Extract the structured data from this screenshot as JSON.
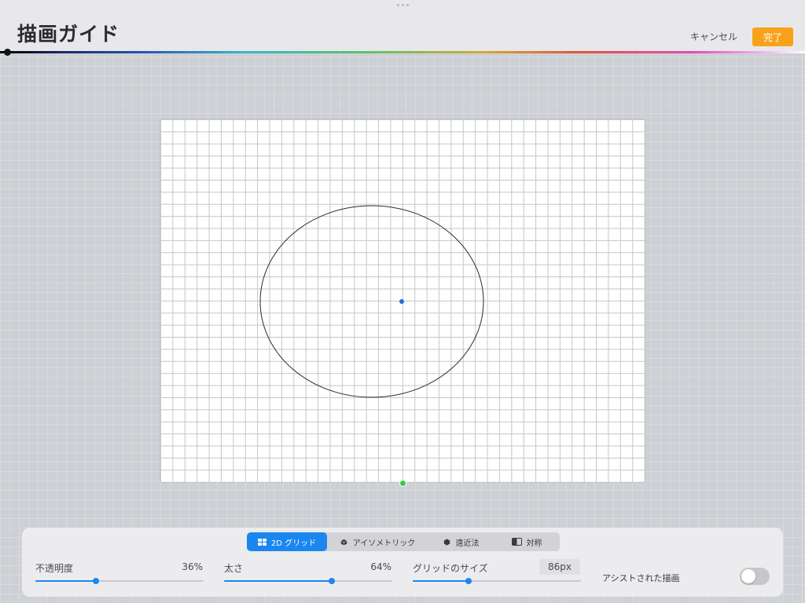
{
  "header": {
    "title": "描画ガイド",
    "cancel_label": "キャンセル",
    "done_label": "完了",
    "accent_color": "#f7a21b"
  },
  "tabs": [
    {
      "label": "2D グリッド",
      "icon": "grid-icon",
      "active": true
    },
    {
      "label": "アイソメトリック",
      "icon": "cube-icon",
      "active": false
    },
    {
      "label": "遠近法",
      "icon": "perspective-icon",
      "active": false
    },
    {
      "label": "対称",
      "icon": "symmetry-icon",
      "active": false
    }
  ],
  "controls": {
    "opacity": {
      "label": "不透明度",
      "value_text": "36%",
      "value": 0.36
    },
    "thickness": {
      "label": "太さ",
      "value_text": "64%",
      "value": 0.64
    },
    "grid_size": {
      "label": "グリッドのサイズ",
      "value_text": "86px",
      "value": 0.33
    }
  },
  "assist": {
    "label": "アシストされた描画",
    "enabled": false
  },
  "colors": {
    "slider_blue": "#1a87f0",
    "center_dot": "#1a73d9",
    "handle_green": "#2ecc47"
  }
}
